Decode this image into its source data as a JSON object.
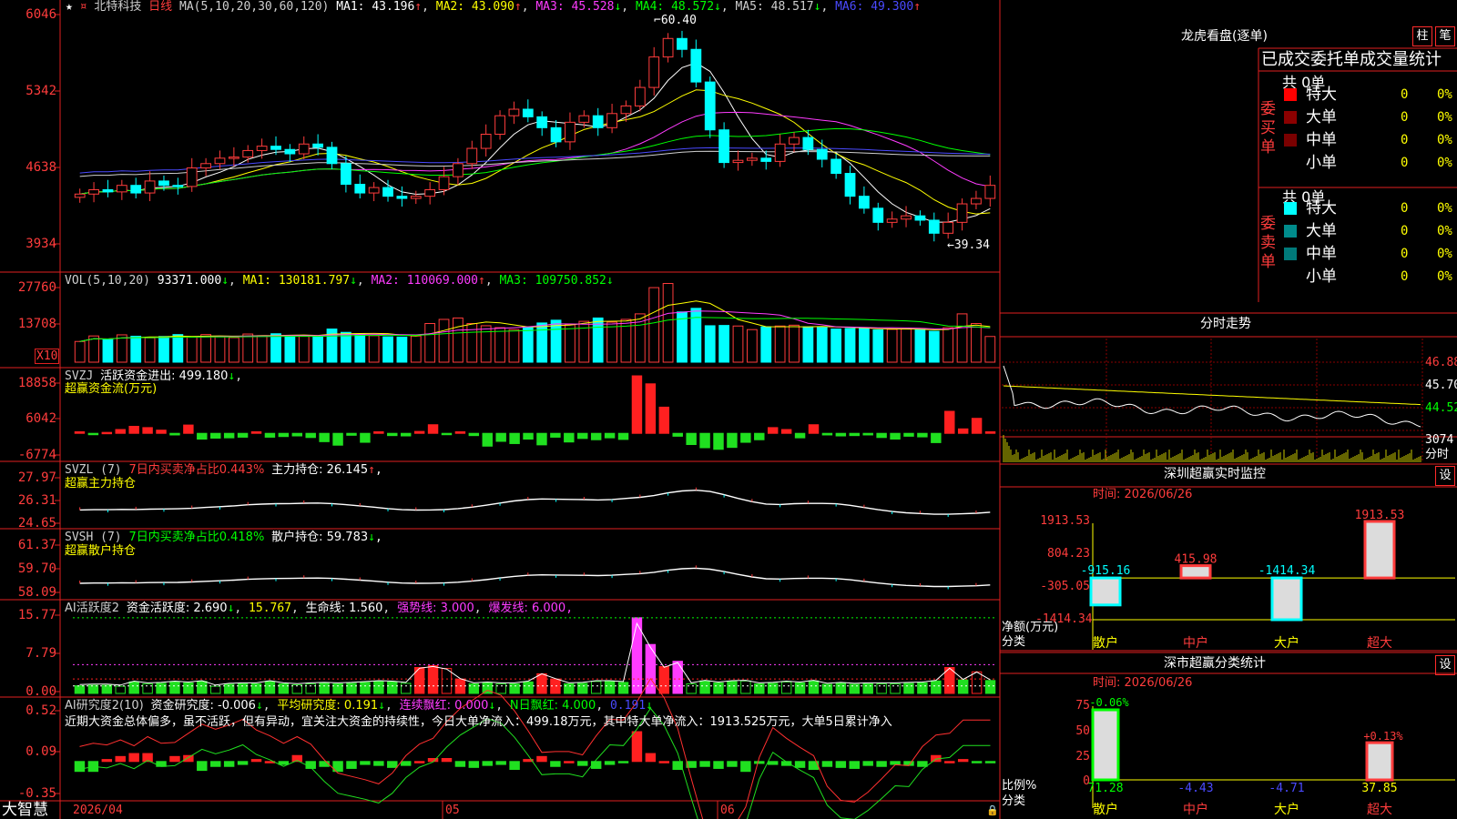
{
  "stock": {
    "star": "★",
    "name": "北特科技",
    "period": "日线"
  },
  "main_panel": {
    "ma_label": "MA(5,10,20,30,60,120)",
    "ma1": "MA1: 43.196",
    "ma1_arrow": "↑",
    "ma2": "MA2: 43.090",
    "ma2_arrow": "↑",
    "ma3": "MA3: 45.528",
    "ma3_arrow": "↓",
    "ma4": "MA4: 48.572",
    "ma4_arrow": "↓",
    "ma5": "MA5: 48.517",
    "ma5_arrow": "↓",
    "ma6": "MA6: 49.300",
    "ma6_arrow": "↑",
    "high_label": "60.40",
    "low_label": "39.34",
    "ticks": [
      "6046",
      "5342",
      "4638",
      "3934"
    ]
  },
  "vol_panel": {
    "title": "VOL(5,10,20)",
    "value": "93371.000",
    "value_arrow": "↓",
    "ma1": "MA1: 130181.797",
    "ma1_arrow": "↓",
    "ma2": "MA2: 110069.000",
    "ma2_arrow": "↑",
    "ma3": "MA3: 109750.852",
    "ma3_arrow": "↓",
    "ticks": [
      "27760",
      "13708"
    ],
    "unit": "X10"
  },
  "svzj_panel": {
    "title": "SVZJ",
    "label": "活跃资金进出: 499.180",
    "arrow": "↓",
    "sub": "超赢资金流(万元)",
    "ticks": [
      "18858",
      "6042",
      "-6774"
    ]
  },
  "svzl_panel": {
    "title": "SVZL (7)",
    "ratio": "7日内买卖净占比0.443%",
    "label": "主力持仓: 26.145",
    "arrow": "↑",
    "sep": ",",
    "sub": "超赢主力持仓",
    "ticks": [
      "27.97",
      "26.31",
      "24.65"
    ]
  },
  "svsh_panel": {
    "title": "SVSH (7)",
    "ratio": "7日内买卖净占比0.418%",
    "label": "散户持仓: 59.783",
    "arrow": "↓",
    "sep": ",",
    "sub": "超赢散户持仓",
    "ticks": [
      "61.37",
      "59.70",
      "58.09"
    ]
  },
  "ai2_panel": {
    "title": "AI活跃度2",
    "active": "资金活跃度: 2.690",
    "active_arrow": "↓",
    "v2": "15.767",
    "life": "生命线: 1.560",
    "strong": "强势线: 3.000",
    "burst": "爆发线: 6.000",
    "sep": ",",
    "ticks": [
      "15.77",
      "7.79",
      "0.00"
    ]
  },
  "ai3_panel": {
    "title": "AI研究度2(10)",
    "research": "资金研究度: -0.006",
    "research_arrow": "↓",
    "avg": "平均研究度: 0.191",
    "avg_arrow": "↓",
    "streak": "连续飘红: 0.000",
    "streak_arrow": "↓",
    "nred": "N日飘红: 4.000",
    "tail": "0.191",
    "tail_arrow": "↓",
    "sep": ",",
    "comment": "近期大资金总体偏多，虽不活跃，但有异动，宜关注大资金的持续性，今日大单净流入：499.18万元，其中特大单净流入：1913.525万元，大单5日累计净入",
    "ticks": [
      "0.52",
      "0.09",
      "-0.35"
    ]
  },
  "bottom_bar": {
    "brand": "大智慧",
    "date": "2026/04",
    "m5": "05",
    "m6": "06"
  },
  "dragon": {
    "title": "龙虎看盘(逐单)",
    "btn_col": "柱",
    "btn_pen": "笔",
    "subtitle": "已成交委托单成交量统计",
    "buy_label": "委买单",
    "sell_label": "委卖单",
    "buy_total": "共 0单",
    "sell_total": "共 0单",
    "rows": [
      {
        "name": "特大",
        "qty": "0",
        "pct": "0%"
      },
      {
        "name": "大单",
        "qty": "0",
        "pct": "0%"
      },
      {
        "name": "中单",
        "qty": "0",
        "pct": "0%"
      },
      {
        "name": "小单",
        "qty": "0",
        "pct": "0%"
      }
    ],
    "buy_colors": [
      "#ff0000",
      "#8b0000",
      "#7a0000"
    ],
    "sell_colors": [
      "#00ffff",
      "#008b8b",
      "#007a7a"
    ]
  },
  "intraday": {
    "title": "分时走势",
    "prices": [
      "46.88",
      "45.70",
      "44.52"
    ],
    "vol": "3074",
    "vol_unit": "分时"
  },
  "sz_monitor": {
    "title": "深圳超赢实时监控",
    "btn": "设",
    "date": "时间: 2026/06/26",
    "yaxis": [
      "1913.53",
      "804.23",
      "-305.05",
      "-1414.34"
    ],
    "ylabel": "净额(万元)",
    "xlabel": "分类",
    "cats": [
      "散户",
      "中户",
      "大户",
      "超大"
    ],
    "values": [
      -915.16,
      415.98,
      -1414.34,
      1913.53
    ],
    "value_labels": [
      "-915.16",
      "415.98",
      "-1414.34",
      "1913.53"
    ]
  },
  "sz_class": {
    "title": "深市超赢分类统计",
    "btn": "设",
    "date": "时间: 2026/06/26",
    "yaxis": [
      "75",
      "50",
      "25",
      "0"
    ],
    "ylabel": "比例%",
    "xlabel": "分类",
    "cats": [
      "散户",
      "中户",
      "大户",
      "超大"
    ],
    "bar_pct": [
      71.28,
      0,
      0,
      37.85
    ],
    "top_labels": [
      "-0.06%",
      "",
      "",
      "+0.13%"
    ],
    "bottom_labels": [
      "71.28",
      "-4.43",
      "-4.71",
      "37.85"
    ]
  },
  "chart_data": [
    {
      "type": "candlestick",
      "title": "北特科技 日线",
      "ylim": [
        39.34,
        60.4
      ],
      "x": [
        "2026/04",
        "05",
        "06"
      ],
      "high": 60.4,
      "low": 39.34,
      "ma": [
        {
          "name": "MA1",
          "value": 43.196
        },
        {
          "name": "MA2",
          "value": 43.09
        },
        {
          "name": "MA3",
          "value": 45.528
        },
        {
          "name": "MA4",
          "value": 48.572
        },
        {
          "name": "MA5",
          "value": 48.517
        },
        {
          "name": "MA6",
          "value": 49.3
        }
      ],
      "close": [
        44.2,
        44.6,
        44.4,
        45.0,
        44.3,
        45.4,
        45.0,
        44.9,
        46.6,
        47.0,
        47.5,
        47.6,
        48.2,
        48.6,
        48.3,
        47.9,
        48.8,
        48.5,
        47.0,
        45.1,
        44.3,
        44.8,
        44.0,
        43.8,
        44.0,
        44.6,
        45.8,
        47.0,
        48.4,
        49.7,
        51.4,
        52.0,
        51.3,
        50.3,
        49.0,
        50.8,
        51.4,
        50.3,
        51.6,
        52.3,
        54.0,
        56.8,
        58.5,
        57.5,
        54.5,
        50.1,
        47.1,
        47.3,
        47.5,
        47.2,
        48.8,
        49.4,
        48.3,
        47.4,
        46.1,
        44.0,
        42.9,
        41.6,
        41.9,
        42.2,
        41.8,
        40.6,
        41.6,
        43.3,
        43.8,
        45.0
      ]
    },
    {
      "type": "bar",
      "title": "VOL(5,10,20)",
      "unit": "X10",
      "ylim": [
        0,
        27760
      ],
      "last": 93371.0,
      "values": [
        7500,
        9500,
        8200,
        9900,
        9400,
        8800,
        9300,
        10000,
        9100,
        10000,
        9200,
        8900,
        10200,
        9600,
        10300,
        9700,
        9500,
        9400,
        12000,
        10800,
        10200,
        9600,
        9200,
        9100,
        9500,
        14000,
        15500,
        16000,
        14000,
        13200,
        12500,
        11800,
        12500,
        14200,
        15200,
        13600,
        14800,
        16000,
        14500,
        15500,
        17500,
        27000,
        28500,
        18200,
        19500,
        13200,
        13300,
        13100,
        11800,
        12800,
        13100,
        13400,
        12800,
        12600,
        12000,
        12200,
        12300,
        11700,
        11900,
        12000,
        11800,
        11200,
        12500,
        17500,
        14000,
        9300
      ]
    },
    {
      "type": "bar",
      "title": "SVZJ",
      "ylim": [
        -6774,
        18858
      ],
      "last": 499.18,
      "values": [
        500,
        -400,
        300,
        1200,
        2200,
        1800,
        1000,
        -500,
        2600,
        -1800,
        -1500,
        -1400,
        -1200,
        500,
        -1200,
        -1000,
        -800,
        -1300,
        -2600,
        -3700,
        -600,
        -2800,
        500,
        -700,
        -800,
        600,
        2700,
        -400,
        500,
        -700,
        -4000,
        -2500,
        -3200,
        -1800,
        -3600,
        -1200,
        -2700,
        -1600,
        -2000,
        -1400,
        -1900,
        18000,
        15500,
        8200,
        -900,
        -3500,
        -4500,
        -5000,
        -4400,
        -2800,
        -2000,
        1800,
        1200,
        -1400,
        2700,
        -500,
        -800,
        -700,
        -500,
        -1300,
        -1800,
        -900,
        -1100,
        -2900,
        6900,
        1400,
        4700,
        499
      ]
    },
    {
      "type": "line",
      "title": "SVZL (7)",
      "ylim": [
        24.65,
        27.97
      ],
      "last": 26.145
    },
    {
      "type": "line",
      "title": "SVSH (7)",
      "ylim": [
        58.09,
        61.37
      ],
      "last": 59.783
    },
    {
      "type": "bar",
      "title": "AI活跃度2",
      "ylim": [
        0,
        15.77
      ],
      "life": 1.56,
      "strong": 3.0,
      "burst": 6.0,
      "last": 2.69,
      "values": [
        1.6,
        1.7,
        1.7,
        1.5,
        2.4,
        2.0,
        2.1,
        2.4,
        2.2,
        2.5,
        1.5,
        1.9,
        2.0,
        2.0,
        2.5,
        2.0,
        1.8,
        2.0,
        2.1,
        2.0,
        2.1,
        2.3,
        2.5,
        2.4,
        2.1,
        5.4,
        5.8,
        5.2,
        3.0,
        2.0,
        2.2,
        2.0,
        2.0,
        2.4,
        4.1,
        3.0,
        2.0,
        2.1,
        2.5,
        2.5,
        2.3,
        15.77,
        10.2,
        5.6,
        6.7,
        2.0,
        2.6,
        2.2,
        2.5,
        2.6,
        2.0,
        2.1,
        2.4,
        2.2,
        2.6,
        1.9,
        2.1,
        1.9,
        2.0,
        2.0,
        2.0,
        2.1,
        2.2,
        2.6,
        5.4,
        2.8,
        4.5,
        2.69
      ]
    },
    {
      "type": "bar",
      "title": "AI研究度2(10)",
      "ylim": [
        -0.35,
        0.52
      ],
      "last": -0.006,
      "avg": 0.191,
      "values": [
        -0.1,
        -0.1,
        0.02,
        0.05,
        0.08,
        0.08,
        -0.05,
        0.05,
        0.06,
        -0.09,
        -0.05,
        -0.05,
        -0.03,
        0.02,
        0.0,
        -0.03,
        0.06,
        -0.07,
        -0.05,
        -0.1,
        -0.07,
        -0.03,
        -0.04,
        -0.06,
        -0.04,
        0.0,
        0.03,
        0.03,
        -0.05,
        -0.06,
        -0.04,
        -0.03,
        -0.08,
        0.02,
        0.05,
        -0.05,
        0.0,
        -0.04,
        -0.07,
        -0.03,
        -0.01,
        0.3,
        0.08,
        0.0,
        -0.08,
        -0.06,
        -0.05,
        -0.07,
        -0.05,
        -0.1,
        -0.02,
        -0.03,
        -0.04,
        -0.06,
        -0.08,
        -0.05,
        -0.06,
        -0.07,
        -0.04,
        -0.05,
        -0.03,
        -0.04,
        -0.05,
        0.06,
        0.0,
        0.02,
        -0.01,
        -0.006
      ]
    }
  ]
}
